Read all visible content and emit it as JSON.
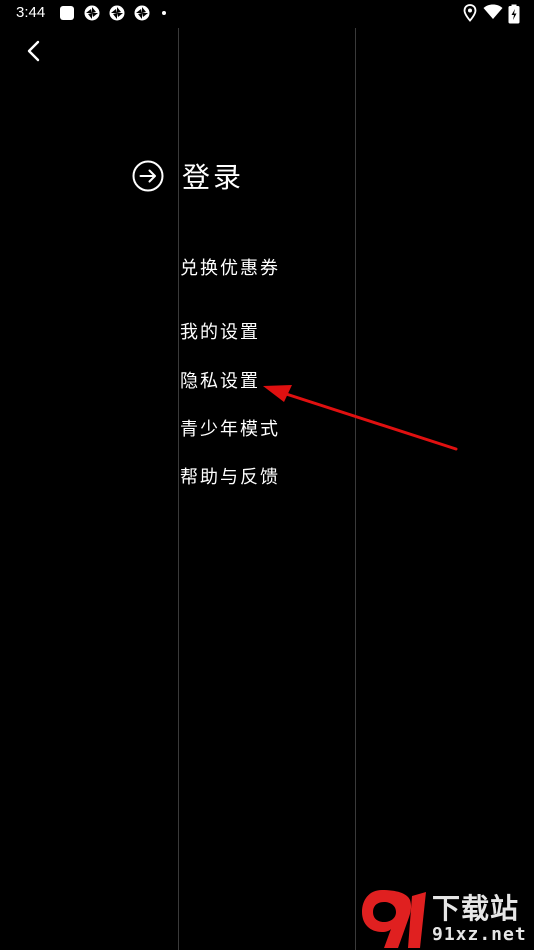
{
  "status_bar": {
    "time": "3:44",
    "notification_icons": [
      "app-square-icon",
      "aperture-icon",
      "aperture-icon",
      "aperture-icon",
      "more-dot-icon"
    ],
    "system_icons": [
      "location-icon",
      "wifi-icon",
      "battery-charging-icon"
    ]
  },
  "header": {
    "back_icon": "chevron-left-icon"
  },
  "login": {
    "icon": "arrow-right-circle-icon",
    "label": "登录"
  },
  "menu": {
    "items": [
      {
        "label": "兑换优惠券"
      },
      {
        "label": "我的设置"
      },
      {
        "label": "隐私设置"
      },
      {
        "label": "青少年模式"
      },
      {
        "label": "帮助与反馈"
      }
    ]
  },
  "annotation": {
    "type": "arrow",
    "color": "#e01010",
    "points_to": "隐私设置"
  },
  "watermark": {
    "line1": "下载站",
    "line2": "91xz.net",
    "logo_color": "#e02020"
  },
  "colors": {
    "background": "#000000",
    "text": "#ffffff",
    "divider": "#3a3a3a"
  }
}
